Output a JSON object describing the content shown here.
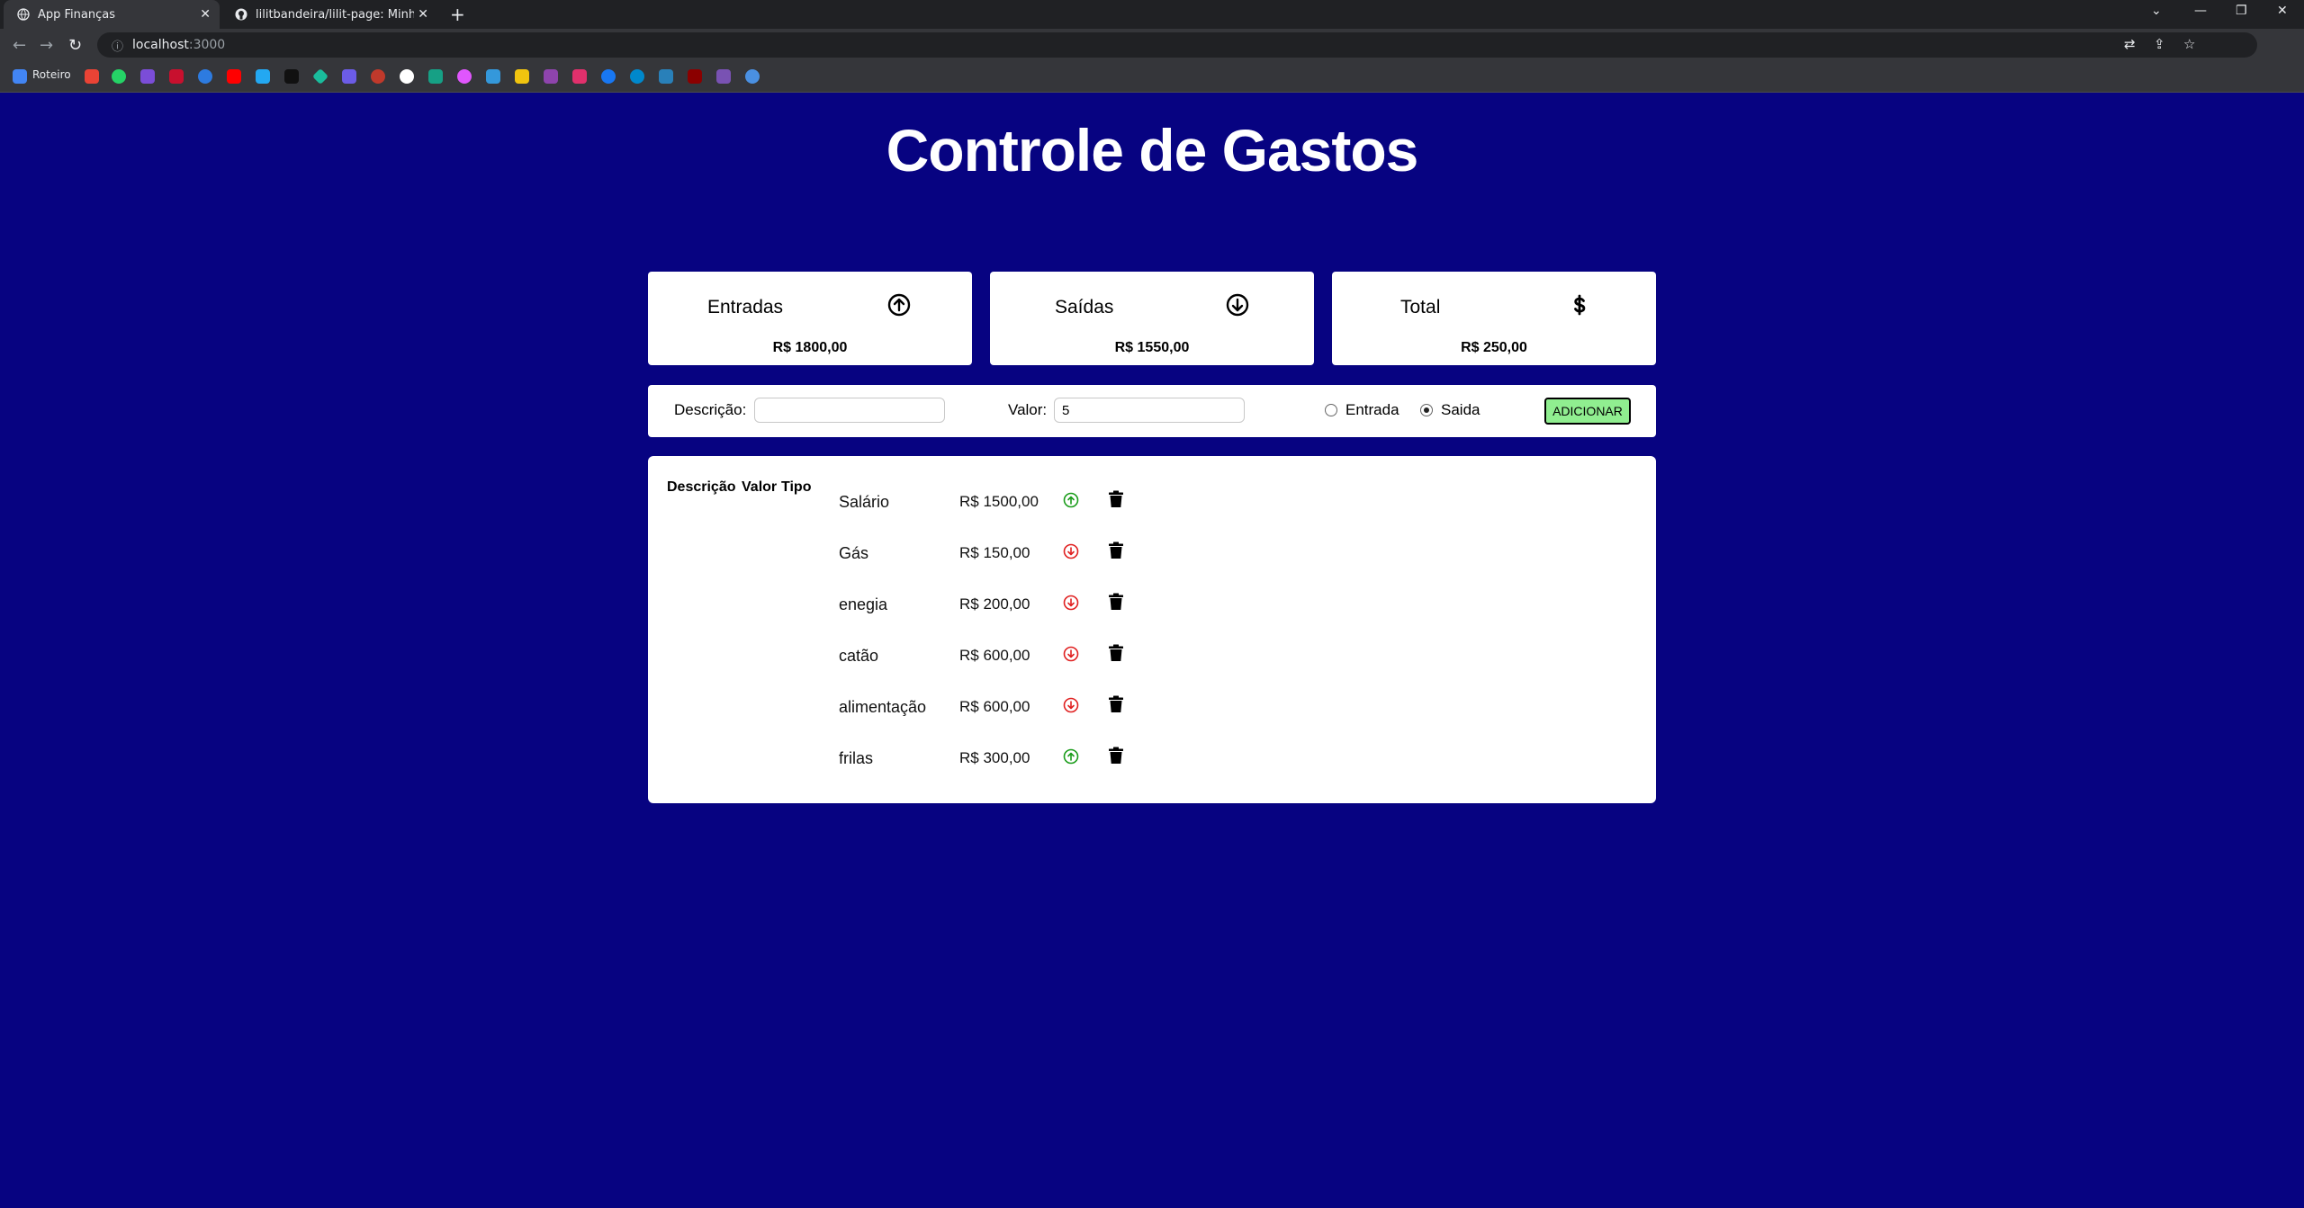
{
  "browser": {
    "tabs": [
      {
        "title": "App Finanças",
        "icon": "globe-icon",
        "active": true
      },
      {
        "title": "lilitbandeira/lilit-page: Minha pri",
        "icon": "github-icon",
        "active": false
      }
    ],
    "url_host": "localhost",
    "url_port": ":3000",
    "bookmarks_label": "Roteiro"
  },
  "app": {
    "title": "Controle de Gastos",
    "cards": [
      {
        "label": "Entradas",
        "value": "R$ 1800,00",
        "icon": "arrow-up-circle-icon"
      },
      {
        "label": "Saídas",
        "value": "R$ 1550,00",
        "icon": "arrow-down-circle-icon"
      },
      {
        "label": "Total",
        "value": "R$ 250,00",
        "icon": "dollar-icon"
      }
    ],
    "form": {
      "description_label": "Descrição:",
      "description_value": "",
      "amount_label": "Valor:",
      "amount_value": "5",
      "radio_income_label": "Entrada",
      "radio_expense_label": "Saida",
      "selected": "Saida",
      "add_button_label": "ADICIONAR"
    },
    "list": {
      "headers": [
        "Descrição",
        "Valor",
        "Tipo"
      ],
      "rows": [
        {
          "description": "Salário",
          "value": "R$ 1500,00",
          "type": "entrada"
        },
        {
          "description": "Gás",
          "value": "R$ 150,00",
          "type": "saida"
        },
        {
          "description": "enegia",
          "value": "R$ 200,00",
          "type": "saida"
        },
        {
          "description": "catão",
          "value": "R$ 600,00",
          "type": "saida"
        },
        {
          "description": "alimentação",
          "value": "R$ 600,00",
          "type": "saida"
        },
        {
          "description": "frilas",
          "value": "R$ 300,00",
          "type": "entrada"
        }
      ]
    },
    "colors": {
      "background": "#070381",
      "income": "#1a9c1a",
      "expense": "#e02020",
      "add_button": "#90ee90"
    }
  }
}
